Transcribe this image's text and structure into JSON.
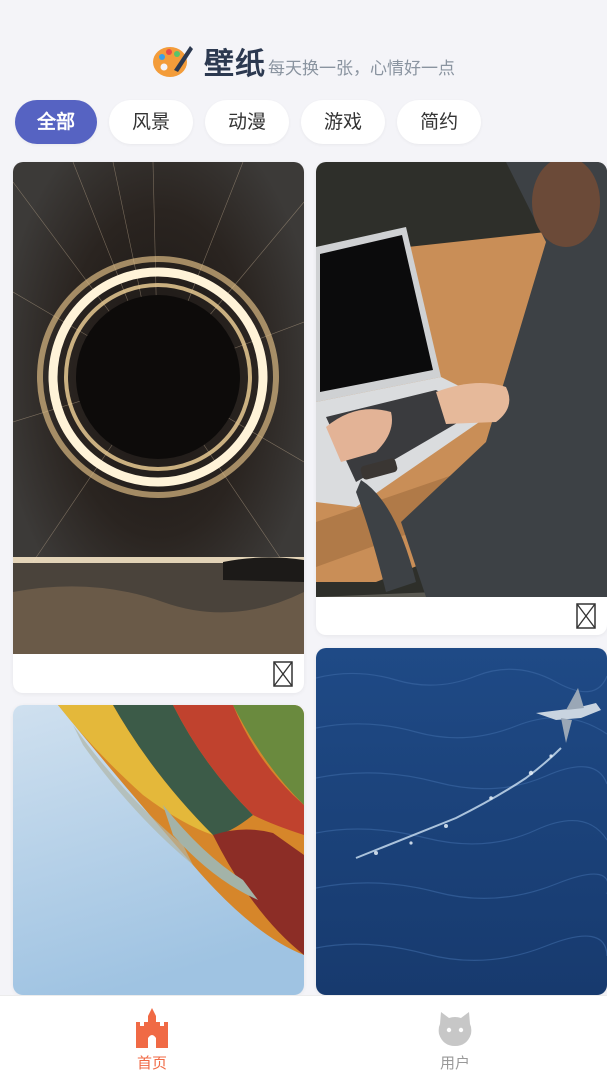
{
  "header": {
    "title": "壁纸",
    "slogan": "每天换一张，心情好一点",
    "logo_icon": "palette-icon"
  },
  "tabs": [
    {
      "label": "全部",
      "active": true
    },
    {
      "label": "风景",
      "active": false
    },
    {
      "label": "动漫",
      "active": false
    },
    {
      "label": "游戏",
      "active": false
    },
    {
      "label": "简约",
      "active": false
    }
  ],
  "wallpapers": [
    {
      "subject": "steel wool light circle",
      "icon": "broken-image-icon"
    },
    {
      "subject": "laptop on wooden table",
      "icon": "broken-image-icon"
    },
    {
      "subject": "hot air balloon"
    },
    {
      "subject": "sea with flying fish"
    }
  ],
  "bottom_nav": {
    "items": [
      {
        "label": "首页",
        "icon": "castle-icon",
        "active": true
      },
      {
        "label": "用户",
        "icon": "user-icon",
        "active": false
      }
    ]
  },
  "colors": {
    "accent": "#5663c2",
    "active_nav": "#f06a45",
    "inactive_nav": "#999999",
    "background": "#f4f4f8"
  }
}
